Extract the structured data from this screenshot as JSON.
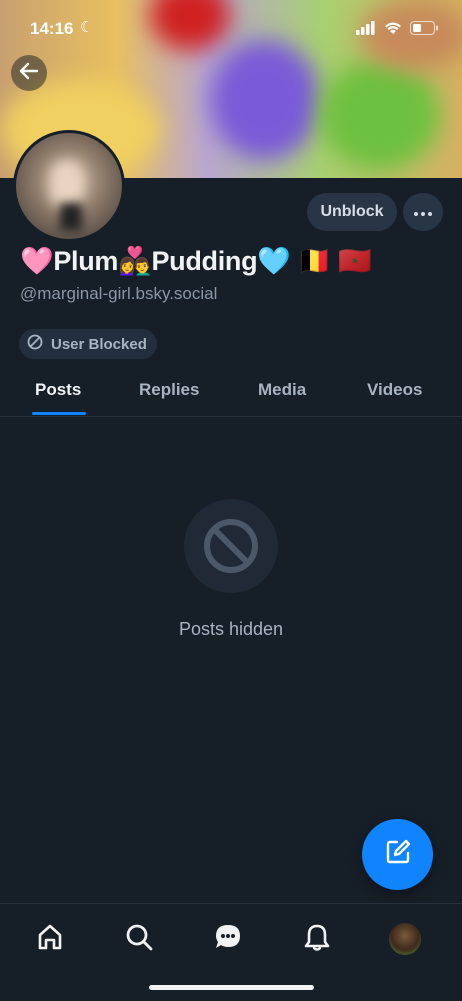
{
  "status_bar": {
    "time": "14:16",
    "moon_icon": "moon-icon"
  },
  "profile": {
    "display_name": "🩷Plum👩‍❤️‍👨Pudding🩵 🇧🇪 🇲🇦",
    "handle": "@marginal-girl.bsky.social",
    "blocked_badge": "User Blocked",
    "unblock_label": "Unblock",
    "more_label": "···"
  },
  "tabs": [
    {
      "label": "Posts",
      "active": true
    },
    {
      "label": "Replies",
      "active": false
    },
    {
      "label": "Media",
      "active": false
    },
    {
      "label": "Videos",
      "active": false
    }
  ],
  "content": {
    "empty_text": "Posts hidden"
  },
  "colors": {
    "accent": "#1083fe",
    "background": "#161e27",
    "pill": "#283544"
  },
  "icons": [
    "back-arrow-icon",
    "ban-icon",
    "compose-icon",
    "home-icon",
    "search-icon",
    "chat-icon",
    "bell-icon",
    "profile-avatar"
  ]
}
